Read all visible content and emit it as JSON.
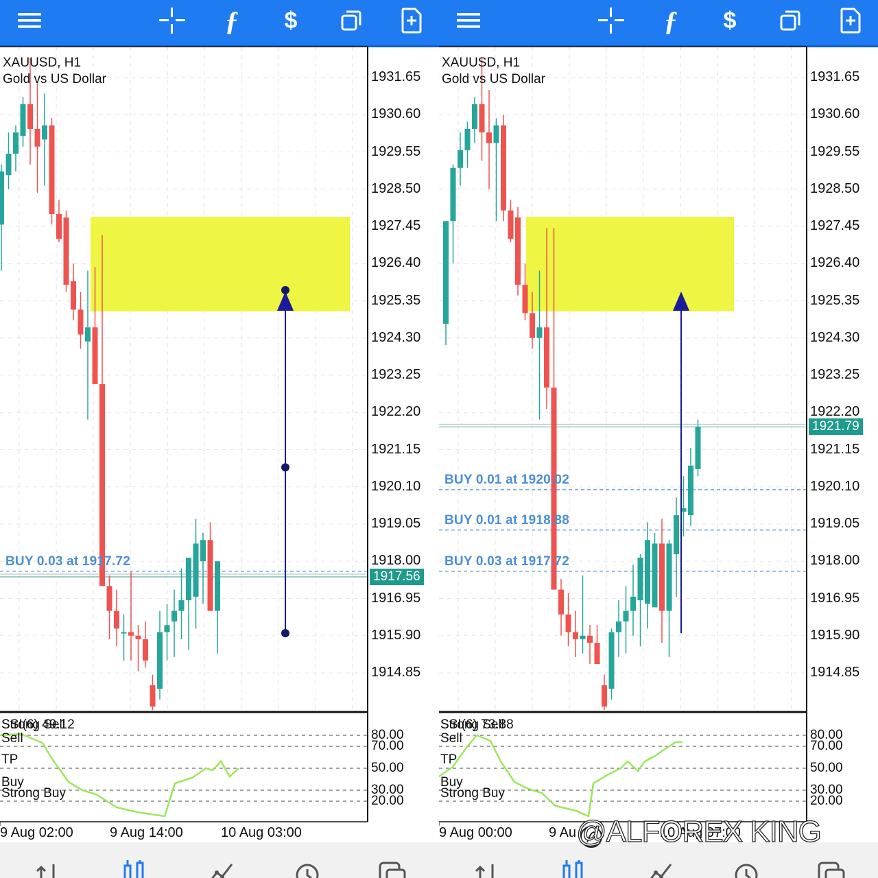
{
  "toolbar": {
    "icons": [
      "menu-icon",
      "crosshair-icon",
      "function-icon",
      "price-alert-icon",
      "window-icon",
      "new-order-icon"
    ]
  },
  "bottom_nav": {
    "icons": [
      "quotes-icon",
      "chart-icon",
      "trade-icon",
      "history-icon",
      "messages-icon"
    ],
    "active": "chart-icon"
  },
  "colors": {
    "toolbar": "#1e7bf2",
    "bull_candle": "#26a69a",
    "bear_candle": "#ef5350",
    "zone": "#eef542",
    "arrow": "#1a1a9a",
    "order_line": "#4a8fd6",
    "osc_line": "#9ae85a",
    "price_tag": "#1f9b8c"
  },
  "left": {
    "symbol": "XAUUSD, H1",
    "description": "Gold vs US Dollar",
    "price_axis": [
      "1931.65",
      "1930.60",
      "1929.55",
      "1928.50",
      "1927.45",
      "1926.40",
      "1925.35",
      "1924.30",
      "1923.25",
      "1922.20",
      "1921.15",
      "1920.10",
      "1919.05",
      "1918.00",
      "1916.95",
      "1915.90",
      "1914.85"
    ],
    "current_price": "1917.56",
    "orders": [
      {
        "label": "BUY 0.03 at 1917.72",
        "price": 1917.72
      }
    ],
    "time_labels": [
      "9 Aug 02:00",
      "9 Aug 14:00",
      "10 Aug 03:00"
    ],
    "oscillator": {
      "title": "SSI(6) 49.12",
      "levels": [
        "80.00",
        "70.00",
        "50.00",
        "30.00",
        "20.00"
      ],
      "zone_labels": [
        "Strong Sell",
        "Sell",
        "TP",
        "Buy",
        "Strong Buy"
      ]
    }
  },
  "right": {
    "symbol": "XAUUSD, H1",
    "description": "Gold vs US Dollar",
    "price_axis": [
      "1931.65",
      "1930.60",
      "1929.55",
      "1928.50",
      "1927.45",
      "1926.40",
      "1925.35",
      "1924.30",
      "1923.25",
      "1922.20",
      "1921.15",
      "1920.10",
      "1919.05",
      "1918.00",
      "1916.95",
      "1915.90",
      "1914.85"
    ],
    "current_price": "1921.79",
    "orders": [
      {
        "label": "BUY 0.01 at 1920.02",
        "price": 1920.02
      },
      {
        "label": "BUY 0.01 at 1918.88",
        "price": 1918.88
      },
      {
        "label": "BUY 0.03 at 1917.72",
        "price": 1917.72
      }
    ],
    "time_labels": [
      "9 Aug 00:00",
      "9 Au",
      "10 Aug 07:00"
    ],
    "oscillator": {
      "title": "SSI(6) 73.88",
      "levels": [
        "80.00",
        "70.00",
        "50.00",
        "30.00",
        "20.00"
      ],
      "zone_labels": [
        "Strong Sell",
        "Sell",
        "TP",
        "Buy",
        "Strong Buy"
      ]
    }
  },
  "watermark": "@ALFOREX KING",
  "chart_data": [
    {
      "type": "candlestick",
      "title": "XAUUSD, H1",
      "subtitle": "Gold vs US Dollar",
      "ylim": [
        1913.8,
        1933.0
      ],
      "x_ticks": [
        "9 Aug 02:00",
        "9 Aug 14:00",
        "10 Aug 03:00"
      ],
      "ohlc": [
        [
          1927.5,
          1929.2,
          1926.2,
          1929.0
        ],
        [
          1928.9,
          1930.1,
          1928.5,
          1929.5
        ],
        [
          1929.5,
          1930.3,
          1929.0,
          1930.1
        ],
        [
          1930.0,
          1931.1,
          1929.7,
          1930.9
        ],
        [
          1930.9,
          1932.2,
          1929.2,
          1930.2
        ],
        [
          1930.2,
          1931.5,
          1928.4,
          1929.7
        ],
        [
          1929.9,
          1931.2,
          1928.6,
          1930.3
        ],
        [
          1930.3,
          1930.5,
          1927.5,
          1927.8
        ],
        [
          1927.8,
          1928.2,
          1927.0,
          1927.1
        ],
        [
          1927.7,
          1927.9,
          1925.6,
          1925.8
        ],
        [
          1925.9,
          1926.4,
          1924.8,
          1925.1
        ],
        [
          1925.1,
          1925.6,
          1924.0,
          1924.4
        ],
        [
          1924.2,
          1926.2,
          1922.0,
          1924.6
        ],
        [
          1924.6,
          1926.3,
          1923.2,
          1923.0
        ],
        [
          1923.0,
          1927.2,
          1918.4,
          1917.3
        ],
        [
          1917.3,
          1917.6,
          1915.8,
          1916.6
        ],
        [
          1916.6,
          1917.2,
          1915.6,
          1916.1
        ],
        [
          1916.0,
          1916.5,
          1915.2,
          1916.0
        ],
        [
          1916.0,
          1917.7,
          1915.2,
          1915.9
        ],
        [
          1915.9,
          1916.2,
          1914.9,
          1915.8
        ],
        [
          1915.8,
          1916.3,
          1915.0,
          1915.2
        ],
        [
          1914.5,
          1914.8,
          1913.8,
          1913.9
        ],
        [
          1914.4,
          1916.6,
          1914.1,
          1916.0
        ],
        [
          1916.0,
          1916.8,
          1915.2,
          1916.2
        ],
        [
          1916.3,
          1917.2,
          1915.3,
          1916.6
        ],
        [
          1916.6,
          1917.8,
          1915.8,
          1916.9
        ],
        [
          1916.9,
          1918.1,
          1915.5,
          1918.1
        ],
        [
          1917.0,
          1919.2,
          1916.1,
          1918.5
        ],
        [
          1918.0,
          1918.8,
          1916.8,
          1918.6
        ],
        [
          1918.6,
          1919.1,
          1917.1,
          1916.6
        ],
        [
          1916.6,
          1918.0,
          1915.4,
          1918.0
        ]
      ],
      "zone": {
        "y_top": 1927.72,
        "y_bottom": 1925.05
      },
      "arrow": {
        "from": 1915.97,
        "to": 1925.65
      },
      "current": 1917.56,
      "orders": [
        1917.72
      ]
    },
    {
      "type": "candlestick",
      "title": "XAUUSD, H1",
      "subtitle": "Gold vs US Dollar",
      "ylim": [
        1913.8,
        1933.0
      ],
      "x_ticks": [
        "9 Aug 00:00",
        "9 Au",
        "10 Aug 07:00"
      ],
      "ohlc": [
        [
          1924.7,
          1925.3,
          1924.1,
          1927.6
        ],
        [
          1927.6,
          1929.2,
          1926.4,
          1929.1
        ],
        [
          1929.1,
          1930.1,
          1928.6,
          1929.6
        ],
        [
          1929.6,
          1930.4,
          1929.1,
          1930.2
        ],
        [
          1930.2,
          1931.1,
          1929.8,
          1930.9
        ],
        [
          1930.9,
          1932.2,
          1929.3,
          1930.1
        ],
        [
          1930.1,
          1931.3,
          1928.5,
          1929.8
        ],
        [
          1929.8,
          1930.5,
          1927.6,
          1930.3
        ],
        [
          1930.3,
          1930.6,
          1927.6,
          1927.9
        ],
        [
          1927.9,
          1928.2,
          1927.0,
          1927.1
        ],
        [
          1927.7,
          1928.0,
          1925.5,
          1925.8
        ],
        [
          1925.8,
          1926.4,
          1924.8,
          1925.0
        ],
        [
          1925.0,
          1925.6,
          1924.0,
          1924.3
        ],
        [
          1924.3,
          1926.2,
          1922.0,
          1924.6
        ],
        [
          1924.6,
          1927.4,
          1922.3,
          1922.9
        ],
        [
          1922.9,
          1927.4,
          1918.5,
          1917.2
        ],
        [
          1917.2,
          1917.5,
          1915.9,
          1916.5
        ],
        [
          1916.5,
          1917.1,
          1915.6,
          1916.0
        ],
        [
          1916.0,
          1916.6,
          1915.3,
          1915.8
        ],
        [
          1915.8,
          1917.6,
          1915.4,
          1915.9
        ],
        [
          1915.9,
          1916.2,
          1915.1,
          1915.7
        ],
        [
          1915.7,
          1916.2,
          1915.1,
          1915.1
        ],
        [
          1914.5,
          1914.8,
          1913.8,
          1913.9
        ],
        [
          1914.4,
          1916.1,
          1914.1,
          1916.0
        ],
        [
          1916.0,
          1916.9,
          1915.3,
          1916.3
        ],
        [
          1916.3,
          1917.3,
          1915.4,
          1916.6
        ],
        [
          1916.6,
          1917.9,
          1915.9,
          1917.0
        ],
        [
          1916.9,
          1918.2,
          1915.6,
          1918.1
        ],
        [
          1916.8,
          1919.1,
          1916.1,
          1918.6
        ],
        [
          1916.7,
          1918.8,
          1916.9,
          1918.5
        ],
        [
          1918.5,
          1919.2,
          1915.7,
          1916.6
        ],
        [
          1916.6,
          1918.6,
          1915.3,
          1918.5
        ],
        [
          1918.2,
          1919.8,
          1917.0,
          1919.3
        ],
        [
          1919.4,
          1920.4,
          1918.7,
          1919.5
        ],
        [
          1919.3,
          1921.2,
          1919.0,
          1920.7
        ],
        [
          1920.6,
          1922.0,
          1920.4,
          1921.8
        ]
      ],
      "zone": {
        "y_top": 1927.72,
        "y_bottom": 1925.05
      },
      "arrow": {
        "from": 1915.97,
        "to": 1925.65
      },
      "current": 1921.79,
      "orders": [
        1920.02,
        1918.88,
        1917.72
      ]
    }
  ]
}
